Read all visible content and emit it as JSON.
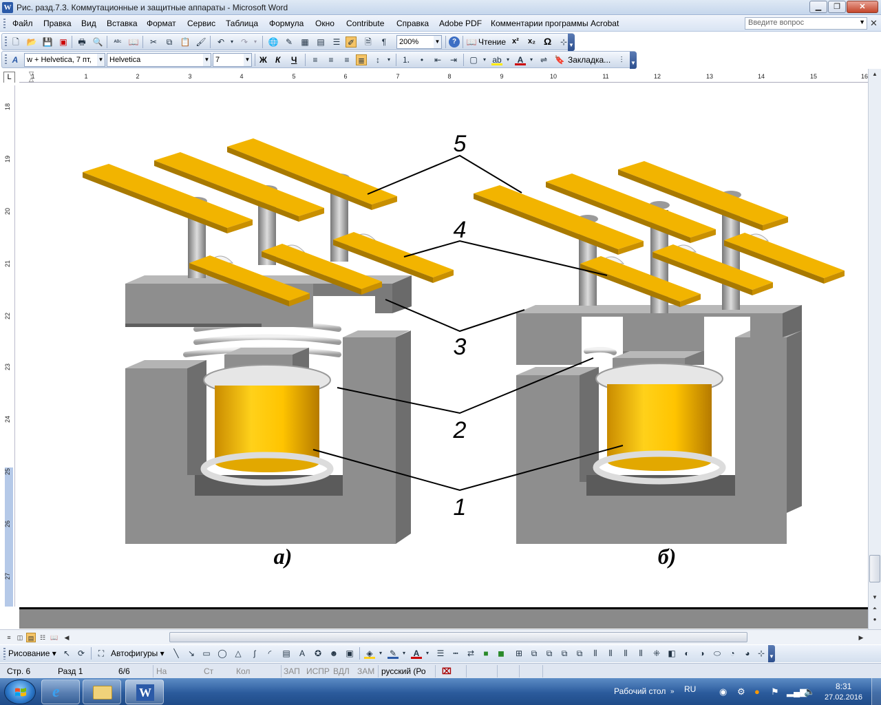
{
  "window": {
    "title": "Рис. разд.7.3. Коммутационные и защитные аппараты - Microsoft Word",
    "app_icon": "W"
  },
  "menu": {
    "items": [
      {
        "label": "Файл"
      },
      {
        "label": "Правка"
      },
      {
        "label": "Вид"
      },
      {
        "label": "Вставка"
      },
      {
        "label": "Формат"
      },
      {
        "label": "Сервис"
      },
      {
        "label": "Таблица"
      },
      {
        "label": "Формула"
      },
      {
        "label": "Окно"
      },
      {
        "label": "Contribute"
      },
      {
        "label": "Справка"
      },
      {
        "label": "Adobe PDF"
      },
      {
        "label": "Комментарии программы Acrobat"
      }
    ],
    "ask_placeholder": "Введите вопрос"
  },
  "standard_toolbar": {
    "zoom": "200%",
    "reading_label": "Чтение",
    "superscript": "x²",
    "subscript": "x₂",
    "omega": "Ω"
  },
  "format_toolbar": {
    "style": "w + Helvetica, 7 пт,",
    "font": "Helvetica",
    "size": "7",
    "bold": "Ж",
    "italic": "К",
    "underline": "Ч",
    "bookmark_label": "Закладка..."
  },
  "ruler": {
    "h_numbers": [
      "2",
      "1",
      "",
      "1",
      "2",
      "3",
      "4",
      "5",
      "6",
      "7",
      "8",
      "9",
      "10",
      "11",
      "12",
      "13",
      "14",
      "15",
      "16"
    ],
    "v_numbers": [
      "18",
      "19",
      "20",
      "21",
      "22",
      "23",
      "24",
      "25",
      "26",
      "27"
    ]
  },
  "figure": {
    "labels": {
      "n5": "5",
      "n4": "4",
      "n3": "3",
      "n2": "2",
      "n1": "1"
    },
    "caption_a": "а)",
    "caption_b": "б)"
  },
  "drawing_toolbar": {
    "drawing_label": "Рисование",
    "autoshapes_label": "Автофигуры"
  },
  "status": {
    "page": "Стр. 6",
    "section": "Разд 1",
    "pages": "6/6",
    "at": "На",
    "line": "Ст",
    "col": "Кол",
    "rec": "ЗАП",
    "trk": "ИСПР",
    "ext": "ВДЛ",
    "ovr": "ЗАМ",
    "lang": "русский (Ро"
  },
  "taskbar": {
    "desktop_label": "Рабочий стол",
    "lang": "RU",
    "time": "8:31",
    "date": "27.02.2016"
  },
  "colors": {
    "gold": "#e6a800",
    "gold_dark": "#b37d00",
    "steel": "#8c8c8c",
    "coil": "#ffc400"
  }
}
